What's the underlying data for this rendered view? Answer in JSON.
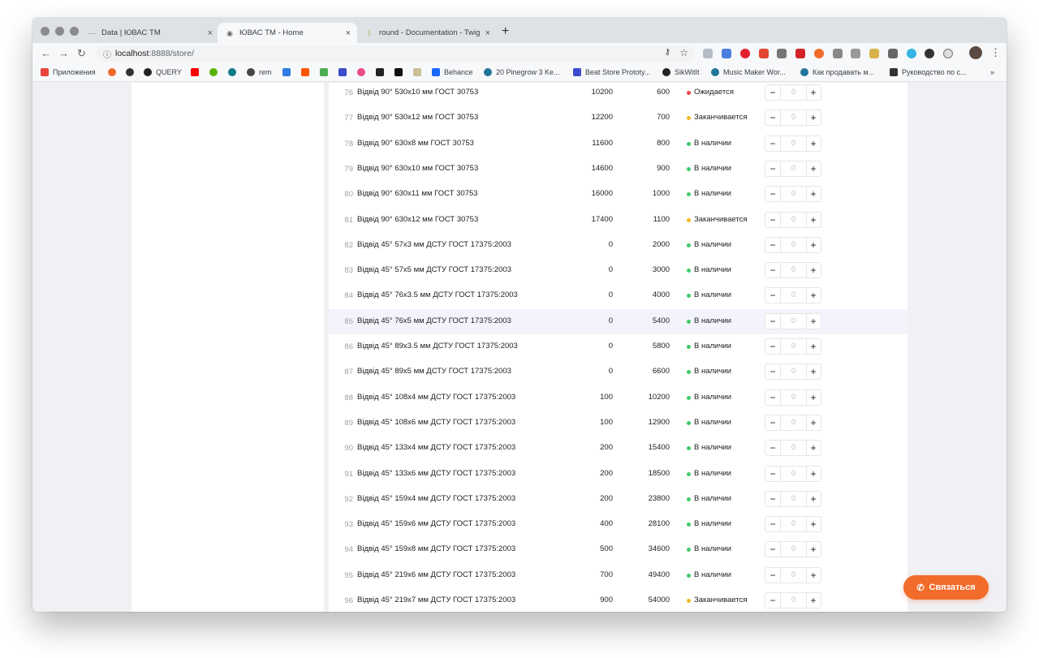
{
  "browser": {
    "tabs": [
      {
        "title": "Data | ЮВАС ТМ",
        "icon": "data-favicon"
      },
      {
        "title": "ЮВАС ТМ - Home",
        "icon": "github-favicon"
      },
      {
        "title": "round - Documentation - Twig",
        "icon": "twig-favicon"
      }
    ],
    "new_tab": "+",
    "url_host": "localhost",
    "url_rest": ":8888/store/",
    "bookmarks": [
      {
        "label": "Приложения",
        "icon": "apps-grid-icon",
        "color": "#e8453c"
      },
      {
        "label": "",
        "icon": "flame-icon",
        "color": "#f26b2a"
      },
      {
        "label": "",
        "icon": "github-icon",
        "color": "#333333"
      },
      {
        "label": "QUERY",
        "icon": "github-icon",
        "color": "#222222"
      },
      {
        "label": "",
        "icon": "youtube-icon",
        "color": "#ff0000"
      },
      {
        "label": "",
        "icon": "green-circle-icon",
        "color": "#59b300"
      },
      {
        "label": "",
        "icon": "teal-circle-icon",
        "color": "#0e7c86"
      },
      {
        "label": "rem",
        "icon": "globe-icon",
        "color": "#444444"
      },
      {
        "label": "",
        "icon": "chat-icon",
        "color": "#2f7de1"
      },
      {
        "label": "",
        "icon": "soundcloud-icon",
        "color": "#ff5500"
      },
      {
        "label": "",
        "icon": "pinwheel-icon",
        "color": "#4caf50"
      },
      {
        "label": "",
        "icon": "w-icon",
        "color": "#3b4cca"
      },
      {
        "label": "",
        "icon": "dribbble-icon",
        "color": "#ea4c89"
      },
      {
        "label": "",
        "icon": "cube-icon",
        "color": "#222222"
      },
      {
        "label": "",
        "icon": "medium-icon",
        "color": "#111111"
      },
      {
        "label": "",
        "icon": "image-icon",
        "color": "#c9c09a"
      },
      {
        "label": "Behance",
        "icon": "behance-icon",
        "color": "#1769ff"
      },
      {
        "label": "20 Pinegrow 3 Ke...",
        "icon": "wordpress-icon",
        "color": "#21759b"
      },
      {
        "label": "Beat Store Prototy...",
        "icon": "w-icon",
        "color": "#3b4cca"
      },
      {
        "label": "SikWitIt",
        "icon": "figure-icon",
        "color": "#222222"
      },
      {
        "label": "Music Maker Wor...",
        "icon": "wordpress-icon",
        "color": "#21759b"
      },
      {
        "label": "Как продавать м...",
        "icon": "wordpress-icon",
        "color": "#21759b"
      },
      {
        "label": "Руководство по с...",
        "icon": "doc-icon",
        "color": "#333333"
      }
    ],
    "more": "»"
  },
  "store": {
    "rows": [
      {
        "num": "76",
        "name": "Відвід 90° 530x10 мм ГОСТ 30753",
        "a": "10200",
        "b": "600",
        "status": "Ожидается",
        "status_color": "#f0474b",
        "qty": "0"
      },
      {
        "num": "77",
        "name": "Відвід 90° 530x12 мм ГОСТ 30753",
        "a": "12200",
        "b": "700",
        "status": "Заканчивается",
        "status_color": "#f5b623",
        "qty": "0"
      },
      {
        "num": "78",
        "name": "Відвід 90° 630x8 мм ГОСТ 30753",
        "a": "11600",
        "b": "800",
        "status": "В наличии",
        "status_color": "#3fca6b",
        "qty": "0"
      },
      {
        "num": "79",
        "name": "Відвід 90° 630x10 мм ГОСТ 30753",
        "a": "14600",
        "b": "900",
        "status": "В наличии",
        "status_color": "#3fca6b",
        "qty": "0"
      },
      {
        "num": "80",
        "name": "Відвід 90° 630x11 мм ГОСТ 30753",
        "a": "16000",
        "b": "1000",
        "status": "В наличии",
        "status_color": "#3fca6b",
        "qty": "0"
      },
      {
        "num": "81",
        "name": "Відвід 90° 630x12 мм ГОСТ 30753",
        "a": "17400",
        "b": "1100",
        "status": "Заканчивается",
        "status_color": "#f5b623",
        "qty": "0"
      },
      {
        "num": "82",
        "name": "Відвід 45° 57x3 мм ДСТУ ГОСТ 17375:2003",
        "a": "0",
        "b": "2000",
        "status": "В наличии",
        "status_color": "#3fca6b",
        "qty": "0"
      },
      {
        "num": "83",
        "name": "Відвід 45° 57x5 мм ДСТУ ГОСТ 17375:2003",
        "a": "0",
        "b": "3000",
        "status": "В наличии",
        "status_color": "#3fca6b",
        "qty": "0"
      },
      {
        "num": "84",
        "name": "Відвід 45° 76x3.5 мм ДСТУ ГОСТ 17375:2003",
        "a": "0",
        "b": "4000",
        "status": "В наличии",
        "status_color": "#3fca6b",
        "qty": "0"
      },
      {
        "num": "85",
        "name": "Відвід 45° 76x5 мм ДСТУ ГОСТ 17375:2003",
        "a": "0",
        "b": "5400",
        "status": "В наличии",
        "status_color": "#3fca6b",
        "qty": "0",
        "highlight": true
      },
      {
        "num": "86",
        "name": "Відвід 45° 89x3.5 мм ДСТУ ГОСТ 17375:2003",
        "a": "0",
        "b": "5800",
        "status": "В наличии",
        "status_color": "#3fca6b",
        "qty": "0"
      },
      {
        "num": "87",
        "name": "Відвід 45° 89x5 мм ДСТУ ГОСТ 17375:2003",
        "a": "0",
        "b": "6600",
        "status": "В наличии",
        "status_color": "#3fca6b",
        "qty": "0"
      },
      {
        "num": "88",
        "name": "Відвід 45° 108x4 мм ДСТУ ГОСТ 17375:2003",
        "a": "100",
        "b": "10200",
        "status": "В наличии",
        "status_color": "#3fca6b",
        "qty": "0"
      },
      {
        "num": "89",
        "name": "Відвід 45° 108x6 мм ДСТУ ГОСТ 17375:2003",
        "a": "100",
        "b": "12900",
        "status": "В наличии",
        "status_color": "#3fca6b",
        "qty": "0"
      },
      {
        "num": "90",
        "name": "Відвід 45° 133x4 мм ДСТУ ГОСТ 17375:2003",
        "a": "200",
        "b": "15400",
        "status": "В наличии",
        "status_color": "#3fca6b",
        "qty": "0"
      },
      {
        "num": "91",
        "name": "Відвід 45° 133x6 мм ДСТУ ГОСТ 17375:2003",
        "a": "200",
        "b": "18500",
        "status": "В наличии",
        "status_color": "#3fca6b",
        "qty": "0"
      },
      {
        "num": "92",
        "name": "Відвід 45° 159x4 мм ДСТУ ГОСТ 17375:2003",
        "a": "200",
        "b": "23800",
        "status": "В наличии",
        "status_color": "#3fca6b",
        "qty": "0"
      },
      {
        "num": "93",
        "name": "Відвід 45° 159x6 мм ДСТУ ГОСТ 17375:2003",
        "a": "400",
        "b": "28100",
        "status": "В наличии",
        "status_color": "#3fca6b",
        "qty": "0"
      },
      {
        "num": "94",
        "name": "Відвід 45° 159x8 мм ДСТУ ГОСТ 17375:2003",
        "a": "500",
        "b": "34600",
        "status": "В наличии",
        "status_color": "#3fca6b",
        "qty": "0"
      },
      {
        "num": "95",
        "name": "Відвід 45° 219x6 мм ДСТУ ГОСТ 17375:2003",
        "a": "700",
        "b": "49400",
        "status": "В наличии",
        "status_color": "#3fca6b",
        "qty": "0"
      },
      {
        "num": "96",
        "name": "Відвід 45° 219x7 мм ДСТУ ГОСТ 17375:2003",
        "a": "900",
        "b": "54000",
        "status": "Заканчивается",
        "status_color": "#f5b623",
        "qty": "0"
      }
    ],
    "minus_label": "−",
    "plus_label": "+"
  },
  "contact_button": {
    "label": "Связаться",
    "color": "#f26b2a",
    "icon": "phone-icon"
  }
}
